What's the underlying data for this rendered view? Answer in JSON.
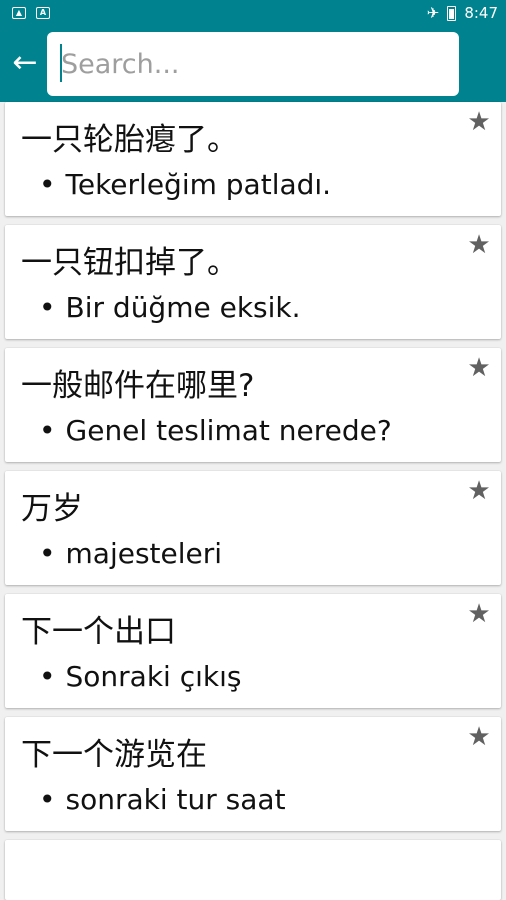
{
  "status_bar": {
    "left_icons": [
      "image-icon",
      "a-icon"
    ],
    "time": "8:47",
    "right_icons": [
      "airplane-icon",
      "battery-icon"
    ]
  },
  "toolbar": {
    "back_icon": "arrow-left-icon",
    "search_placeholder": "Search..."
  },
  "phrases": [
    {
      "zh": "一只轮胎瘪了。",
      "tr": "Tekerleğim patladı."
    },
    {
      "zh": "一只钮扣掉了。",
      "tr": "Bir düğme eksik."
    },
    {
      "zh": "一般邮件在哪里?",
      "tr": "Genel teslimat nerede?"
    },
    {
      "zh": "万岁",
      "tr": "majesteleri"
    },
    {
      "zh": "下一个出口",
      "tr": "Sonraki çıkış"
    },
    {
      "zh": "下一个游览在",
      "tr": "sonraki tur saat"
    }
  ],
  "colors": {
    "primary": "#00838f",
    "star": "#616161",
    "background": "#f0f0f0"
  }
}
